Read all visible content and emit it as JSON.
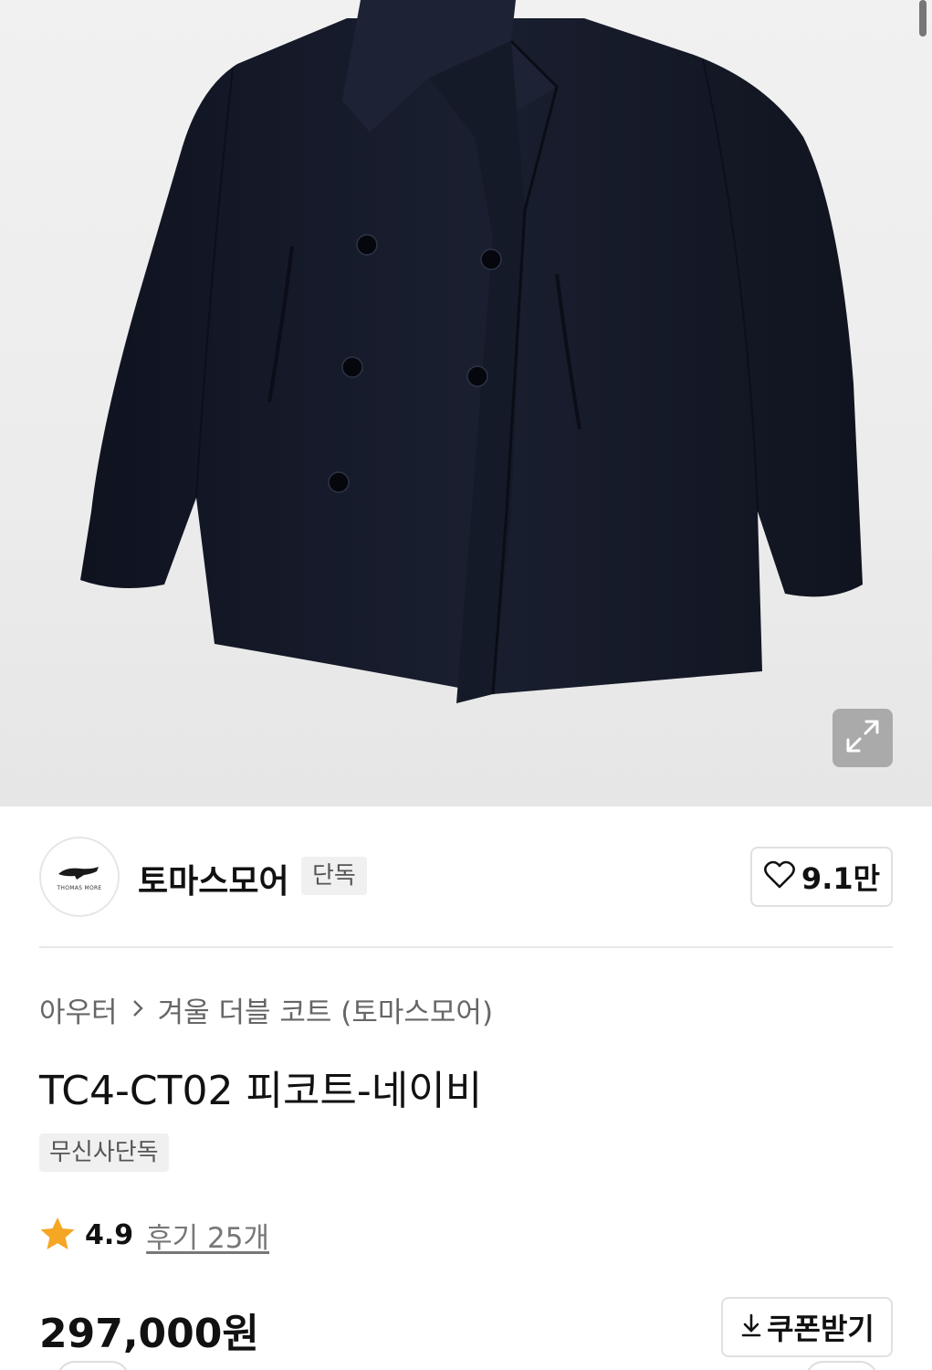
{
  "product_image": {
    "subject": "navy pea coat",
    "expand_icon": "expand-icon"
  },
  "brand": {
    "logo_text": "THOMAS MORE",
    "name": "토마스모어",
    "badge": "단독",
    "like_icon": "heart-icon",
    "like_count": "9.1만"
  },
  "breadcrumb": {
    "category": "아우터",
    "separator_icon": "chevron-right-icon",
    "subcategory": "겨울 더블 코트 (토마스모어)"
  },
  "product": {
    "title": "TC4-CT02 피코트-네이비",
    "exclusive_tag": "무신사단독"
  },
  "rating": {
    "star_icon": "star-icon",
    "value": "4.9",
    "review_label": "후기 25개"
  },
  "price": {
    "amount": "297,000원"
  },
  "coupon": {
    "icon": "download-icon",
    "label": "쿠폰받기"
  },
  "colors": {
    "star": "#f5a623",
    "coat": "#141826",
    "border": "#e0e0e0"
  }
}
